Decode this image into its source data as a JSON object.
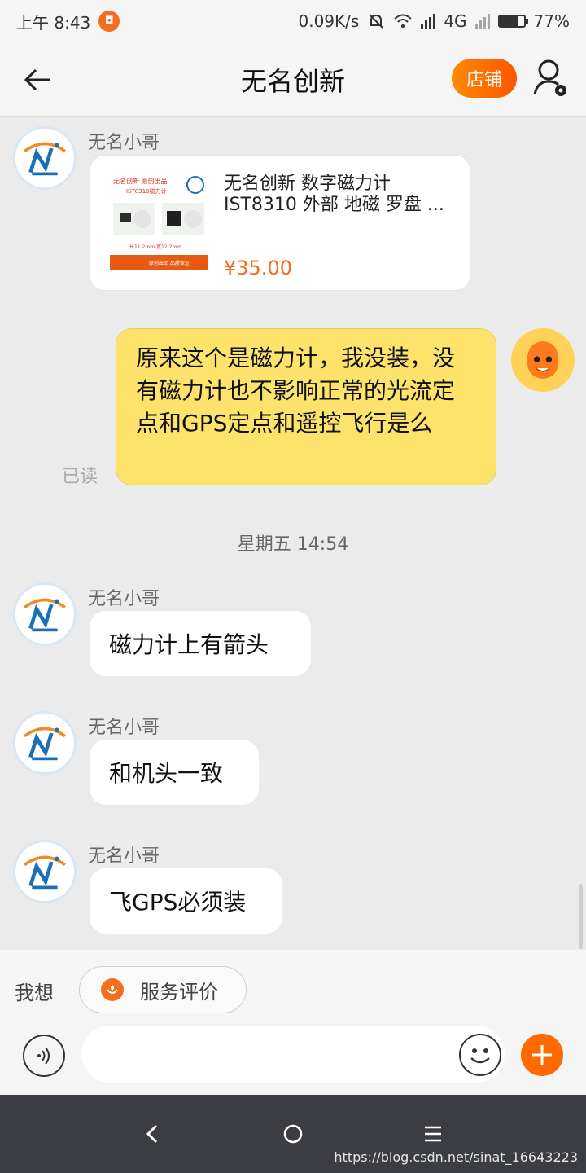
{
  "status_bar": {
    "time": "上午 8:43",
    "net_speed": "0.09K/s",
    "network": "4G",
    "battery": "77%",
    "battery_level": 0.77
  },
  "nav": {
    "title": "无名创新",
    "shop_label": "店铺"
  },
  "messages": {
    "m1": {
      "sender": "无名小哥",
      "product": {
        "title": "无名创新 数字磁力计 IST8310 外部 地磁 罗盘 ...",
        "price": "¥35.00",
        "thumb_top_text": "无名创新 原创出品",
        "thumb_sub_text": "IST8310磁力计",
        "thumb_dim_text": "长11.2mm 宽12.2mm",
        "thumb_bottom_text": "原创出品 品质保证"
      }
    },
    "m2": {
      "text": "原来这个是磁力计，我没装，没有磁力计也不影响正常的光流定点和GPS定点和遥控飞行是么",
      "read_status": "已读"
    },
    "timestamp": "星期五 14:54",
    "m3": {
      "sender": "无名小哥",
      "text": "磁力计上有箭头"
    },
    "m4": {
      "sender": "无名小哥",
      "text": "和机头一致"
    },
    "m5": {
      "sender": "无名小哥",
      "text": "飞GPS必须装"
    }
  },
  "composer": {
    "quick_label": "我想",
    "quick_chip": "服务评价",
    "input_value": "",
    "input_placeholder": ""
  },
  "watermark": "https://blog.csdn.net/sinat_16643223",
  "colors": {
    "accent": "#f46f1d",
    "my_bubble": "#fde36b",
    "background": "#ebebeb"
  }
}
